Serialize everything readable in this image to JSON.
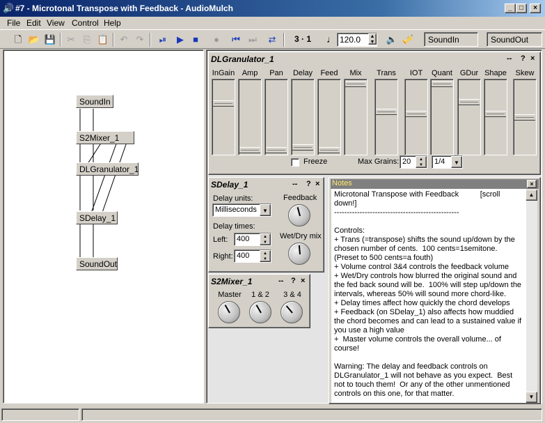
{
  "window": {
    "title": "#7 - Microtonal Transpose with Feedback - AudioMulch",
    "icon": "speaker-icon",
    "controls": [
      "_",
      "□",
      "×"
    ]
  },
  "menu": [
    {
      "label": "File"
    },
    {
      "label": "Edit"
    },
    {
      "label": "View"
    },
    {
      "label": "Control"
    },
    {
      "label": "Help"
    }
  ],
  "toolbar": {
    "position": "3 · 1",
    "tempo": "120.0",
    "input": "SoundIn",
    "output": "SoundOut",
    "icons": [
      "new-icon",
      "open-icon",
      "save-icon",
      "cut-icon",
      "copy-icon",
      "paste-icon",
      "undo-icon",
      "redo-icon",
      "play-start-icon",
      "play-icon",
      "stop-icon",
      "record-icon",
      "rewind-icon",
      "forward-icon",
      "loop-icon",
      "note-icon",
      "volume-icon",
      "link-icon"
    ]
  },
  "patcher": {
    "nodes": [
      {
        "label": "SoundIn"
      },
      {
        "label": "S2Mixer_1"
      },
      {
        "label": "DLGranulator_1"
      },
      {
        "label": "SDelay_1"
      },
      {
        "label": "SoundOut"
      }
    ]
  },
  "granulator": {
    "title": "DLGranulator_1",
    "controls": [
      "--",
      "?",
      "×"
    ],
    "sliders": [
      {
        "label": "InGain",
        "value": 0.7
      },
      {
        "label": "Amp",
        "value": 0.02
      },
      {
        "label": "Pan",
        "value": 0.02
      },
      {
        "label": "Delay",
        "value": 0.06
      },
      {
        "label": "Feed",
        "value": 0.02
      },
      {
        "label": "Mix",
        "value": 0.98
      },
      {
        "label": "Trans",
        "value": 0.58
      },
      {
        "label": "IOT",
        "value": 0.55
      },
      {
        "label": "Quant",
        "value": 0.98
      },
      {
        "label": "GDur",
        "value": 0.72
      },
      {
        "label": "Shape",
        "value": 0.55
      },
      {
        "label": "Skew",
        "value": 0.5
      }
    ],
    "freeze_label": "Freeze",
    "freeze_checked": false,
    "max_grains_label": "Max Grains:",
    "max_grains_value": "20",
    "quant_value": "1/4"
  },
  "sdelay": {
    "title": "SDelay_1",
    "controls": [
      "--",
      "?",
      "×"
    ],
    "units_label": "Delay units:",
    "units_value": "Milliseconds",
    "feedback_label": "Feedback",
    "times_label": "Delay times:",
    "left_label": "Left:",
    "left_value": "400",
    "right_label": "Right:",
    "right_value": "400",
    "wetdry_label": "Wet/Dry mix"
  },
  "s2mixer": {
    "title": "S2Mixer_1",
    "controls": [
      "--",
      "?",
      "×"
    ],
    "knobs": [
      {
        "label": "Master",
        "angle": -30
      },
      {
        "label": "1 & 2",
        "angle": -30
      },
      {
        "label": "3 & 4",
        "angle": -40
      }
    ]
  },
  "notes": {
    "title": "Notes",
    "text": "Microtonal Transpose with Feedback          [scroll down!]\n-------------------------------------------------\n\nControls:\n+ Trans (=transpose) shifts the sound up/down by the chosen number of cents.  100 cents=1semitone.\n(Preset to 500 cents=a fouth)\n+ Volume control 3&4 controls the feedback volume\n+ Wet/Dry controls how blurred the original sound and the fed back sound will be.  100% will step up/down the intervals, whereas 50% will sound more chord-like.\n+ Delay times affect how quickly the chord develops\n+ Feedback (on SDelay_1) also affects how muddied the chord becomes and can lead to a sustained value if you use a high value\n+  Master volume controls the overall volume... of course!\n\nWarning: The delay and feedback controls on DLGranulator_1 will not behave as you expect.  Best not to touch them!  Or any of the other unmentioned controls on this one, for that matter.\n\nBeware of feedback from the speakers to the microphone!"
  }
}
